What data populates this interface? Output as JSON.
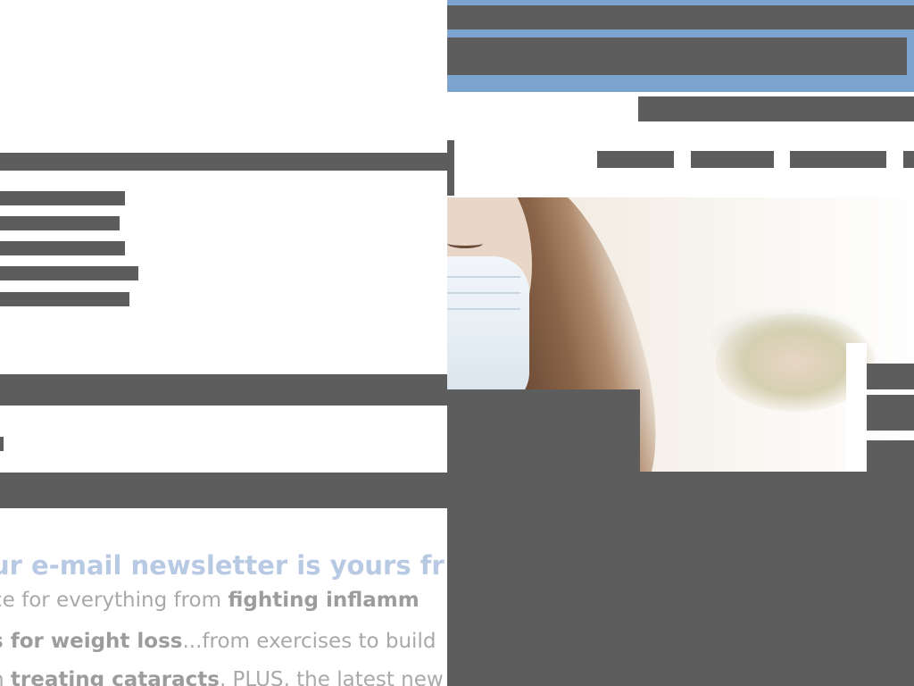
{
  "newsletter": {
    "headline": "ur e-mail newsletter is yours fr",
    "line1_pre": "ce for everything from ",
    "line1_bold": "fighting inflamm",
    "line2_bold": "s for weight loss",
    "line2_post": "...from exercises to build",
    "line3_pre": "n ",
    "line3_bold": "treating cataracts",
    "line3_post": ". PLUS, the latest new"
  },
  "hero": {
    "icon": "woman-with-face-mask-image"
  },
  "colors": {
    "placeholder_bar": "#5d5d5d",
    "header_blue": "#7da3cf",
    "headline_text": "#b8c9e4",
    "body_text": "#a9a9a9"
  }
}
